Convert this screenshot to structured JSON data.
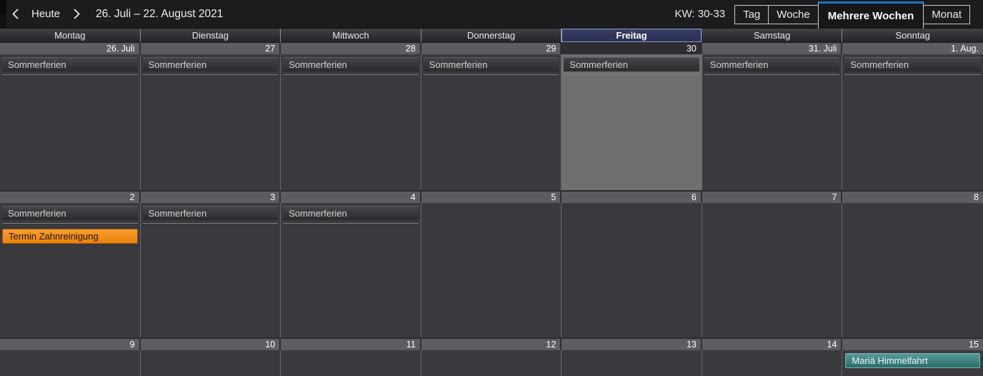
{
  "toolbar": {
    "today_label": "Heute",
    "date_range": "26. Juli – 22. August 2021",
    "calendar_week_label": "KW: 30-33",
    "view_tabs": [
      {
        "label": "Tag",
        "active": false
      },
      {
        "label": "Woche",
        "active": false
      },
      {
        "label": "Mehrere Wochen",
        "active": true
      },
      {
        "label": "Monat",
        "active": false
      }
    ]
  },
  "calendar": {
    "day_headers": [
      "Montag",
      "Dienstag",
      "Mittwoch",
      "Donnerstag",
      "Freitag",
      "Samstag",
      "Sonntag"
    ],
    "today_day_index": 4,
    "weeks": [
      {
        "days": [
          {
            "date": "26. Juli",
            "events": [
              {
                "title": "Sommerferien",
                "color": "gray"
              }
            ]
          },
          {
            "date": "27",
            "events": [
              {
                "title": "Sommerferien",
                "color": "gray"
              }
            ]
          },
          {
            "date": "28",
            "events": [
              {
                "title": "Sommerferien",
                "color": "gray"
              }
            ]
          },
          {
            "date": "29",
            "events": [
              {
                "title": "Sommerferien",
                "color": "gray"
              }
            ]
          },
          {
            "date": "30",
            "today": true,
            "events": [
              {
                "title": "Sommerferien",
                "color": "gray"
              }
            ]
          },
          {
            "date": "31. Juli",
            "events": [
              {
                "title": "Sommerferien",
                "color": "gray"
              }
            ]
          },
          {
            "date": "1. Aug.",
            "events": [
              {
                "title": "Sommerferien",
                "color": "gray"
              }
            ]
          }
        ]
      },
      {
        "days": [
          {
            "date": "2",
            "events": [
              {
                "title": "Sommerferien",
                "color": "gray"
              },
              {
                "title": "Termin Zahnreinigung",
                "color": "orange"
              }
            ]
          },
          {
            "date": "3",
            "events": [
              {
                "title": "Sommerferien",
                "color": "gray"
              }
            ]
          },
          {
            "date": "4",
            "events": [
              {
                "title": "Sommerferien",
                "color": "gray"
              }
            ]
          },
          {
            "date": "5",
            "events": []
          },
          {
            "date": "6",
            "events": []
          },
          {
            "date": "7",
            "events": []
          },
          {
            "date": "8",
            "events": []
          }
        ]
      },
      {
        "days": [
          {
            "date": "9",
            "events": []
          },
          {
            "date": "10",
            "events": []
          },
          {
            "date": "11",
            "events": []
          },
          {
            "date": "12",
            "events": []
          },
          {
            "date": "13",
            "events": []
          },
          {
            "date": "14",
            "events": []
          },
          {
            "date": "15",
            "events": [
              {
                "title": "Mariä Himmelfahrt",
                "color": "teal"
              }
            ]
          }
        ]
      }
    ]
  },
  "colors": {
    "accent_blue": "#1f70c1",
    "today_border": "#99a3d3",
    "today_header_bg": "#32355b",
    "today_body_bg": "#6f6f72",
    "date_strip_bg": "#5d5d61",
    "cell_body_bg": "#3a3a3e",
    "event_orange": "#f08a15",
    "event_teal": "#3d8a87"
  }
}
